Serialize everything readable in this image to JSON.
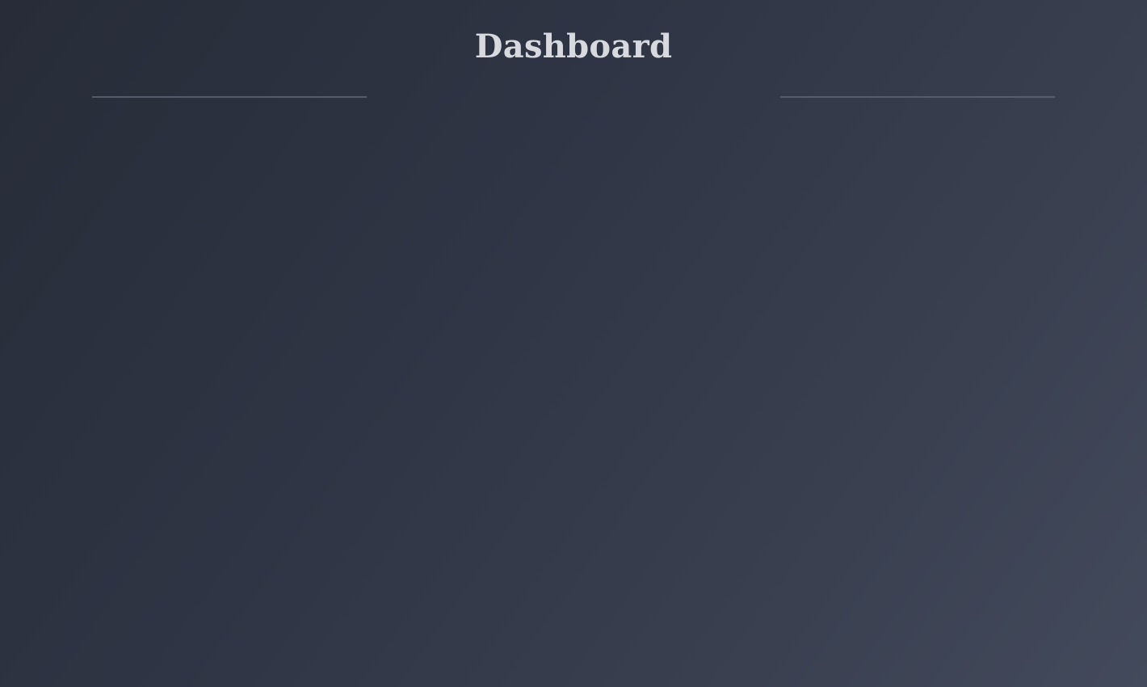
{
  "header": {
    "title": "Dashboard"
  },
  "colors": {
    "background_start": "#272c38",
    "background_end": "#434a5b",
    "title_text": "#d7d9de",
    "divider": "#5b6170"
  }
}
